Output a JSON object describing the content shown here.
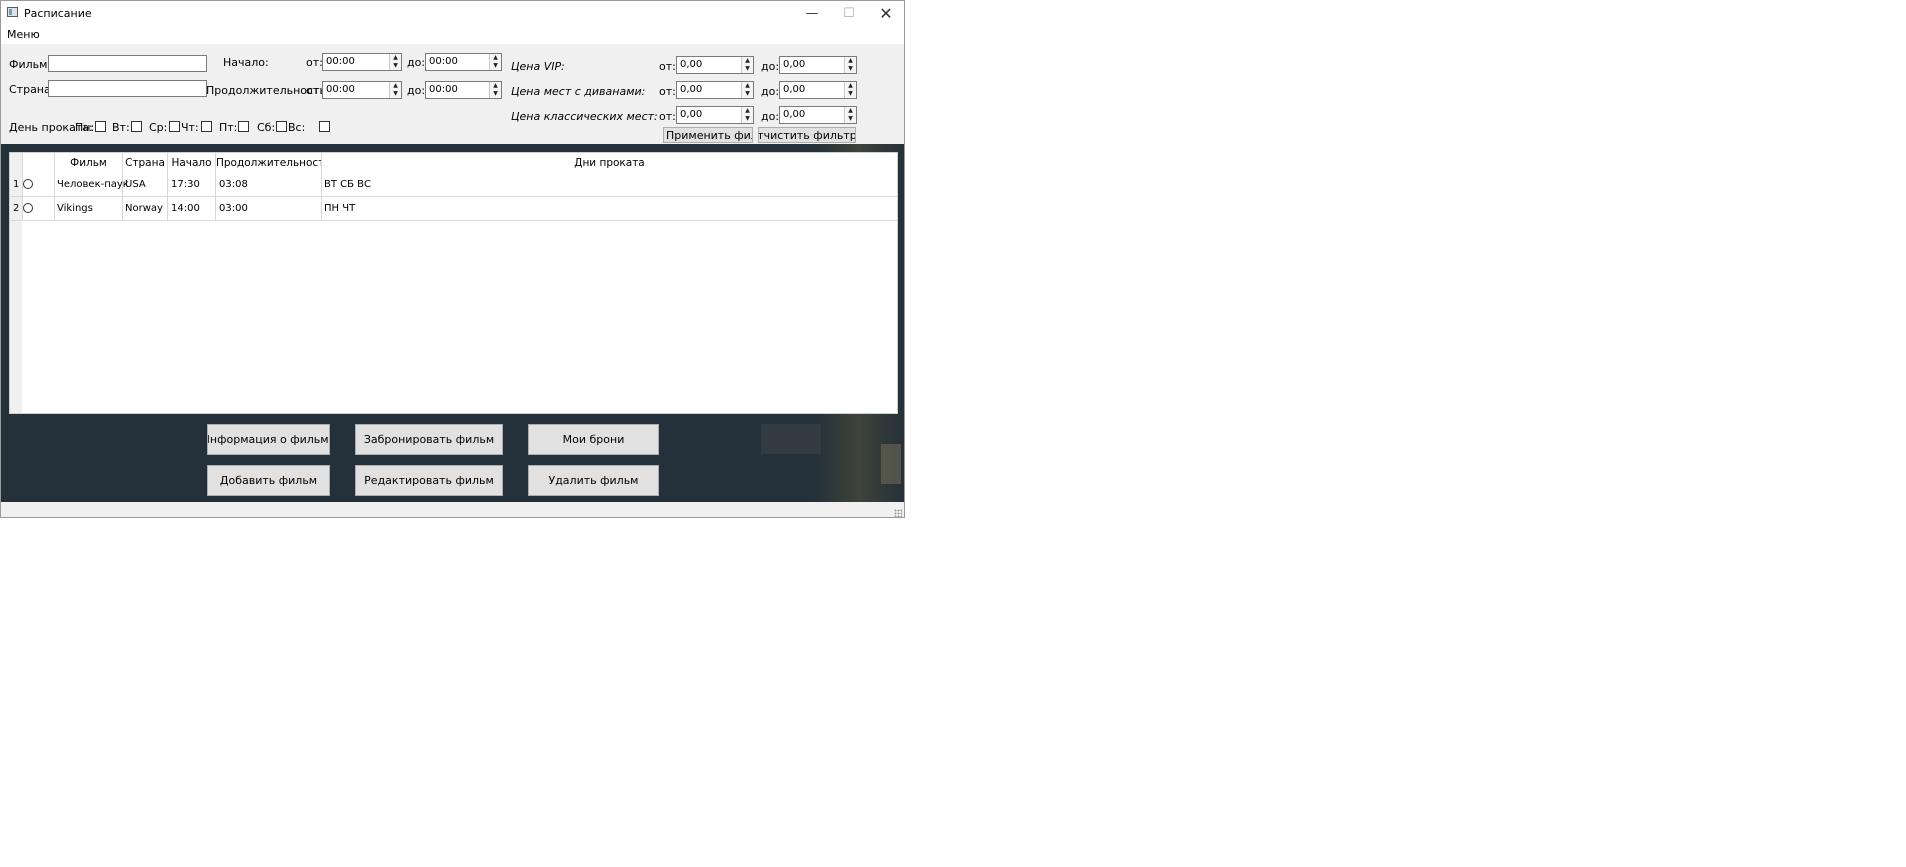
{
  "window": {
    "title": "Расписание",
    "minimize": "—",
    "maximize": "☐",
    "close": "✕"
  },
  "menu": {
    "label": "Меню"
  },
  "filters": {
    "film_label": "Фильм:",
    "country_label": "Страна:",
    "start_label": "Начало:",
    "duration_label": "Продолжительность:",
    "from_label": "от:",
    "to_label": "до:",
    "start_from": "00:00",
    "start_to": "00:00",
    "duration_from": "00:00",
    "duration_to": "00:00",
    "vip_label": "Цена VIP:",
    "sofa_label": "Цена мест с диванами:",
    "classic_label": "Цена классических мест:",
    "vip_from": "0,00",
    "vip_to": "0,00",
    "sofa_from": "0,00",
    "sofa_to": "0,00",
    "classic_from": "0,00",
    "classic_to": "0,00",
    "days_label": "День проката:",
    "days": [
      "Пн:",
      "Вт:",
      "Ср:",
      "Чт:",
      "Пт:",
      "Сб:",
      "Вс:"
    ],
    "apply_button": "Применить фильтры",
    "clear_button": "Отчистить фильтры"
  },
  "table": {
    "headers": [
      "Фильм",
      "Страна",
      "Начало",
      "Продолжительность",
      "Дни проката"
    ],
    "rows": [
      {
        "num": "1",
        "film": "Человек-паук",
        "country": "USA",
        "start": "17:30",
        "duration": "03:08",
        "days": "ВТ СБ ВС"
      },
      {
        "num": "2",
        "film": "Vikings",
        "country": "Norway",
        "start": "14:00",
        "duration": "03:00",
        "days": "ПН ЧТ"
      }
    ]
  },
  "actions": {
    "info": "Информация о фильме",
    "book": "Забронировать фильм",
    "my_bookings": "Мои брони",
    "add": "Добавить фильм",
    "edit": "Редактировать фильм",
    "delete": "Удалить фильм"
  }
}
